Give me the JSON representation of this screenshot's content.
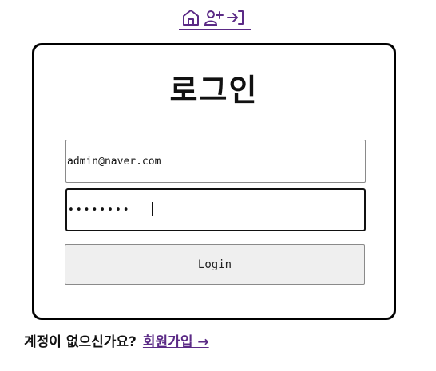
{
  "nav": {
    "icons": [
      "home-icon",
      "user-plus-icon",
      "login-arrow-icon"
    ]
  },
  "login": {
    "title": "로그인",
    "email_value": "admin@naver.com",
    "password_masked": "••••••••",
    "login_button": "Login"
  },
  "signup": {
    "prompt": "계정이 없으신가요?",
    "link": "회원가입 →"
  },
  "colors": {
    "link": "#5b2a86",
    "button_bg": "#efefef",
    "border": "#000000"
  }
}
